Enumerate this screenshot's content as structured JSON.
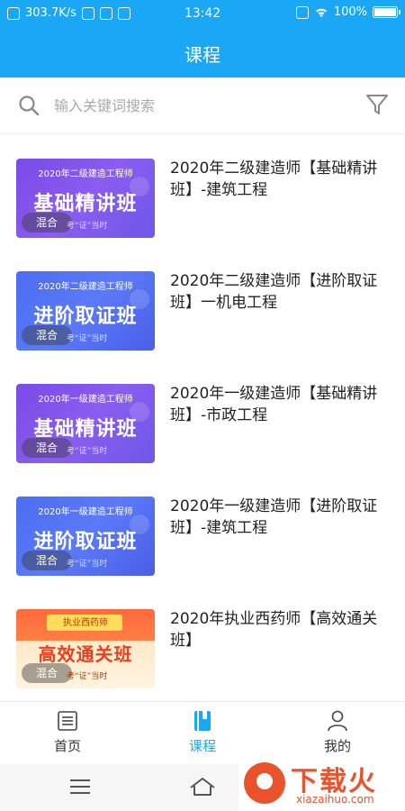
{
  "status_bar": {
    "speed": "303.7K/s",
    "time": "13:42",
    "battery": "100%"
  },
  "header": {
    "title": "课程"
  },
  "search": {
    "placeholder": "输入关键词搜索"
  },
  "courses": [
    {
      "title": "2020年二级建造师【基础精讲班】-建筑工程",
      "thumb_sub": "2020年二级建造工程师",
      "thumb_big": "基础精讲班",
      "mode": "混合",
      "tag": "考“证”当时",
      "theme": "purple"
    },
    {
      "title": "2020年二级建造师【进阶取证班】一机电工程",
      "thumb_sub": "2020年二级建造工程师",
      "thumb_big": "进阶取证班",
      "mode": "混合",
      "tag": "考“证”当时",
      "theme": "blue"
    },
    {
      "title": "2020年一级建造师【基础精讲班】-市政工程",
      "thumb_sub": "2020年一级建造工程师",
      "thumb_big": "基础精讲班",
      "mode": "混合",
      "tag": "考“证”当时",
      "theme": "purple"
    },
    {
      "title": "2020年一级建造师【进阶取证班】-建筑工程",
      "thumb_sub": "2020年一级建造工程师",
      "thumb_big": "进阶取证班",
      "mode": "混合",
      "tag": "考“证”当时",
      "theme": "blue"
    },
    {
      "title": "2020年执业西药师【高效通关班】",
      "thumb_sub": "执业西药师",
      "thumb_big": "高效通关班",
      "mode": "混合",
      "tag": "考“证”当时",
      "theme": "orange"
    }
  ],
  "tabs": [
    {
      "label": "首页",
      "icon": "home-list-icon",
      "active": false
    },
    {
      "label": "课程",
      "icon": "book-icon",
      "active": true
    },
    {
      "label": "我的",
      "icon": "user-icon",
      "active": false
    }
  ],
  "watermark": {
    "cn": "下载火",
    "en": "xiazaihuo.com"
  },
  "colors": {
    "accent": "#1aa7f5"
  }
}
